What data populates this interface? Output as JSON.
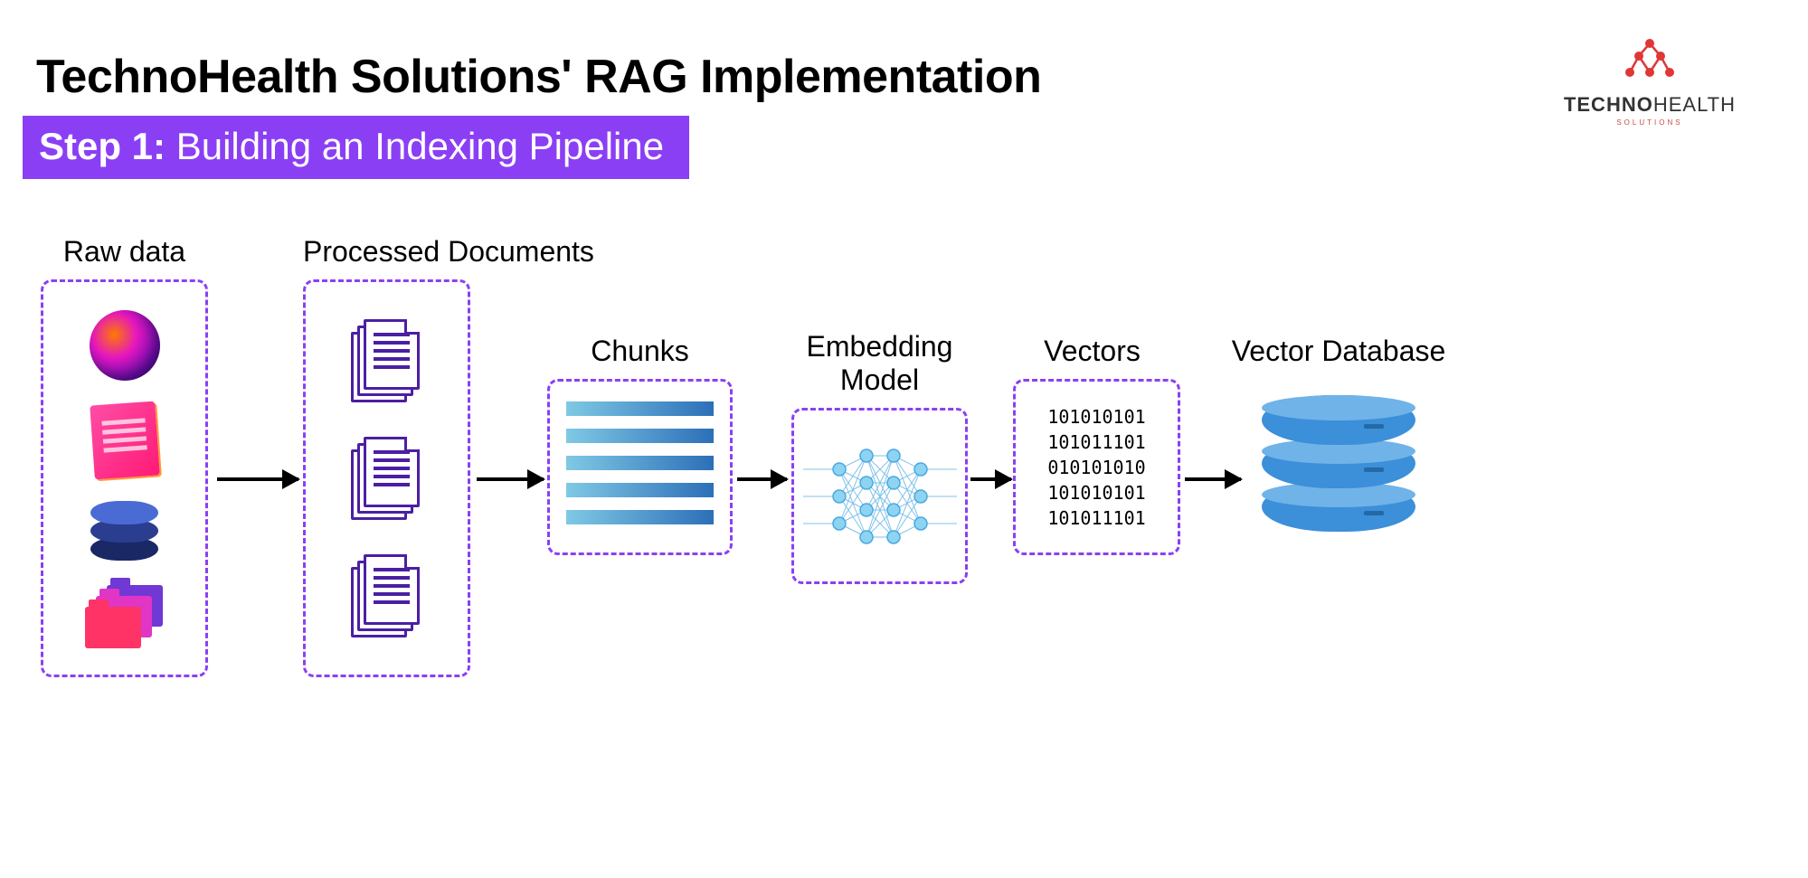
{
  "title": "TechnoHealth Solutions' RAG Implementation",
  "step": {
    "prefix": "Step 1:",
    "text": " Building an Indexing Pipeline"
  },
  "logo": {
    "brand_bold": "TECHNO",
    "brand_thin": "HEALTH",
    "subtitle": "SOLUTIONS"
  },
  "pipeline": {
    "raw": {
      "label": "Raw data"
    },
    "processed": {
      "label": "Processed Documents"
    },
    "chunks": {
      "label": "Chunks"
    },
    "embedding": {
      "label": "Embedding Model"
    },
    "vectors": {
      "label": "Vectors",
      "lines": [
        "101010101",
        "101011101",
        "010101010",
        "101010101",
        "101011101"
      ]
    },
    "database": {
      "label": "Vector Database"
    }
  }
}
